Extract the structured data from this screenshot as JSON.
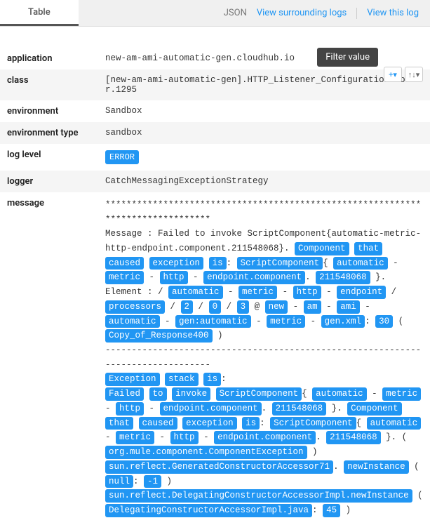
{
  "tabs": {
    "table": "Table",
    "json": "JSON",
    "surrounding": "View surrounding logs",
    "viewthis": "View this log"
  },
  "tooltip": "Filter value",
  "rows": {
    "application": {
      "key": "application",
      "value": "new-am-ami-automatic-gen.cloudhub.io"
    },
    "class": {
      "key": "class",
      "value": "[new-am-ami-automatic-gen].HTTP_Listener_Configuration.worker.1295"
    },
    "environment": {
      "key": "environment",
      "value": "Sandbox"
    },
    "environment_type": {
      "key": "environment type",
      "value": "sandbox"
    },
    "log_level": {
      "key": "log level",
      "badge": "ERROR"
    },
    "logger": {
      "key": "logger",
      "value": "CatchMessagingExceptionStrategy"
    },
    "message": {
      "key": "message"
    }
  },
  "message_segments": [
    {
      "t": "plain",
      "v": "********************************************************************************"
    },
    {
      "t": "br"
    },
    {
      "t": "plain",
      "v": "Message               : Failed to invoke ScriptComponent{automatic-metric-http-endpoint.component.211548068}. "
    },
    {
      "t": "tok",
      "v": "Component"
    },
    {
      "t": "plain",
      "v": " "
    },
    {
      "t": "tok",
      "v": "that"
    },
    {
      "t": "plain",
      "v": " "
    },
    {
      "t": "tok",
      "v": "caused"
    },
    {
      "t": "plain",
      "v": " "
    },
    {
      "t": "tok",
      "v": "exception"
    },
    {
      "t": "plain",
      "v": " "
    },
    {
      "t": "tok",
      "v": "is"
    },
    {
      "t": "plain",
      "v": ": "
    },
    {
      "t": "tok",
      "v": "ScriptComponent"
    },
    {
      "t": "plain",
      "v": "{ "
    },
    {
      "t": "tok",
      "v": "automatic"
    },
    {
      "t": "plain",
      "v": " - "
    },
    {
      "t": "tok",
      "v": "metric"
    },
    {
      "t": "plain",
      "v": " - "
    },
    {
      "t": "tok",
      "v": "http"
    },
    {
      "t": "plain",
      "v": " - "
    },
    {
      "t": "tok",
      "v": "endpoint.component"
    },
    {
      "t": "plain",
      "v": ". "
    },
    {
      "t": "tok",
      "v": "211548068"
    },
    {
      "t": "plain",
      "v": " }."
    },
    {
      "t": "br"
    },
    {
      "t": "plain",
      "v": "Element               : / "
    },
    {
      "t": "tok",
      "v": "automatic"
    },
    {
      "t": "plain",
      "v": " - "
    },
    {
      "t": "tok",
      "v": "metric"
    },
    {
      "t": "plain",
      "v": " - "
    },
    {
      "t": "tok",
      "v": "http"
    },
    {
      "t": "plain",
      "v": " - "
    },
    {
      "t": "tok",
      "v": "endpoint"
    },
    {
      "t": "plain",
      "v": " / "
    },
    {
      "t": "tok",
      "v": "processors"
    },
    {
      "t": "plain",
      "v": " / "
    },
    {
      "t": "tok",
      "v": "2"
    },
    {
      "t": "plain",
      "v": " / "
    },
    {
      "t": "tok",
      "v": "0"
    },
    {
      "t": "plain",
      "v": " / "
    },
    {
      "t": "tok",
      "v": "3"
    },
    {
      "t": "plain",
      "v": " @ "
    },
    {
      "t": "tok",
      "v": "new"
    },
    {
      "t": "plain",
      "v": " - "
    },
    {
      "t": "tok",
      "v": "am"
    },
    {
      "t": "plain",
      "v": " - "
    },
    {
      "t": "tok",
      "v": "ami"
    },
    {
      "t": "plain",
      "v": " - "
    },
    {
      "t": "tok",
      "v": "automatic"
    },
    {
      "t": "plain",
      "v": " - "
    },
    {
      "t": "tok",
      "v": "gen:automatic"
    },
    {
      "t": "plain",
      "v": " - "
    },
    {
      "t": "tok",
      "v": "metric"
    },
    {
      "t": "plain",
      "v": " - "
    },
    {
      "t": "tok",
      "v": "gen.xml"
    },
    {
      "t": "plain",
      "v": ": "
    },
    {
      "t": "tok",
      "v": "30"
    },
    {
      "t": "plain",
      "v": " ( "
    },
    {
      "t": "tok",
      "v": "Copy_of_Response400"
    },
    {
      "t": "plain",
      "v": " )"
    },
    {
      "t": "br"
    },
    {
      "t": "plain",
      "v": "--------------------------------------------------------------------------------"
    },
    {
      "t": "br"
    },
    {
      "t": "tok",
      "v": "Exception"
    },
    {
      "t": "plain",
      "v": " "
    },
    {
      "t": "tok",
      "v": "stack"
    },
    {
      "t": "plain",
      "v": " "
    },
    {
      "t": "tok",
      "v": "is"
    },
    {
      "t": "plain",
      "v": ":"
    },
    {
      "t": "br"
    },
    {
      "t": "tok",
      "v": "Failed"
    },
    {
      "t": "plain",
      "v": " "
    },
    {
      "t": "tok",
      "v": "to"
    },
    {
      "t": "plain",
      "v": " "
    },
    {
      "t": "tok",
      "v": "invoke"
    },
    {
      "t": "plain",
      "v": " "
    },
    {
      "t": "tok",
      "v": "ScriptComponent"
    },
    {
      "t": "plain",
      "v": "{ "
    },
    {
      "t": "tok",
      "v": "automatic"
    },
    {
      "t": "plain",
      "v": " - "
    },
    {
      "t": "tok",
      "v": "metric"
    },
    {
      "t": "plain",
      "v": " - "
    },
    {
      "t": "tok",
      "v": "http"
    },
    {
      "t": "plain",
      "v": " - "
    },
    {
      "t": "tok",
      "v": "endpoint.component"
    },
    {
      "t": "plain",
      "v": ". "
    },
    {
      "t": "tok",
      "v": "211548068"
    },
    {
      "t": "plain",
      "v": " }. "
    },
    {
      "t": "tok",
      "v": "Component"
    },
    {
      "t": "plain",
      "v": " "
    },
    {
      "t": "tok",
      "v": "that"
    },
    {
      "t": "plain",
      "v": " "
    },
    {
      "t": "tok",
      "v": "caused"
    },
    {
      "t": "plain",
      "v": " "
    },
    {
      "t": "tok",
      "v": "exception"
    },
    {
      "t": "plain",
      "v": " "
    },
    {
      "t": "tok",
      "v": "is"
    },
    {
      "t": "plain",
      "v": ": "
    },
    {
      "t": "tok",
      "v": "ScriptComponent"
    },
    {
      "t": "plain",
      "v": "{ "
    },
    {
      "t": "tok",
      "v": "automatic"
    },
    {
      "t": "plain",
      "v": " - "
    },
    {
      "t": "tok",
      "v": "metric"
    },
    {
      "t": "plain",
      "v": " - "
    },
    {
      "t": "tok",
      "v": "http"
    },
    {
      "t": "plain",
      "v": " - "
    },
    {
      "t": "tok",
      "v": "endpoint.component"
    },
    {
      "t": "plain",
      "v": ". "
    },
    {
      "t": "tok",
      "v": "211548068"
    },
    {
      "t": "plain",
      "v": " }. ( "
    },
    {
      "t": "tok",
      "v": "org.mule.component.ComponentException"
    },
    {
      "t": "plain",
      "v": " )"
    },
    {
      "t": "br"
    },
    {
      "t": "plain",
      "v": "  "
    },
    {
      "t": "tok",
      "v": "sun.reflect.GeneratedConstructorAccessor71"
    },
    {
      "t": "plain",
      "v": ". "
    },
    {
      "t": "tok",
      "v": "newInstance"
    },
    {
      "t": "plain",
      "v": " ( "
    },
    {
      "t": "tok",
      "v": "null"
    },
    {
      "t": "plain",
      "v": ": "
    },
    {
      "t": "tok",
      "v": "-1"
    },
    {
      "t": "plain",
      "v": " )"
    },
    {
      "t": "br"
    },
    {
      "t": "plain",
      "v": "  "
    },
    {
      "t": "tok",
      "v": "sun.reflect.DelegatingConstructorAccessorImpl.newInstance"
    },
    {
      "t": "plain",
      "v": " ( "
    },
    {
      "t": "tok",
      "v": "DelegatingConstructorAccessorImpl.java"
    },
    {
      "t": "plain",
      "v": ": "
    },
    {
      "t": "tok",
      "v": "45"
    },
    {
      "t": "plain",
      "v": " )"
    }
  ]
}
